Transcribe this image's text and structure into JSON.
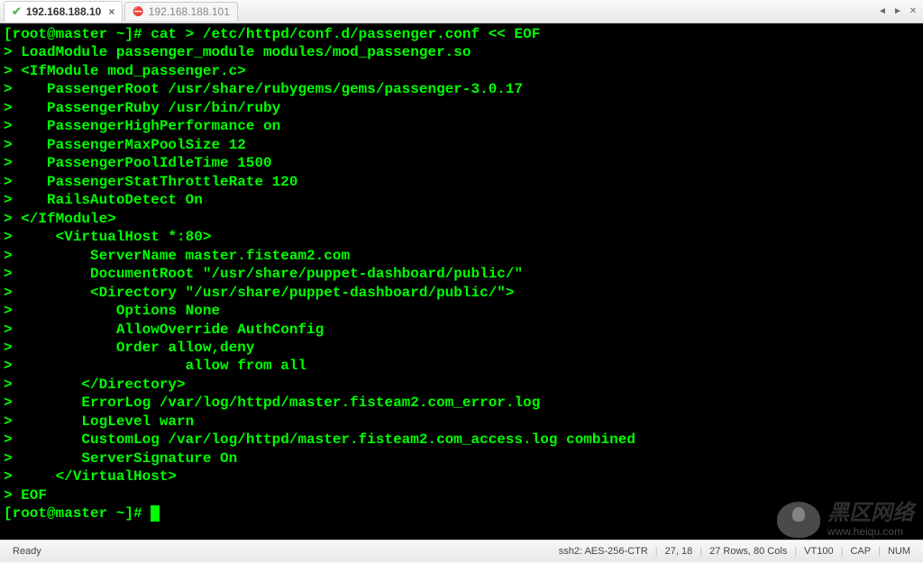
{
  "tabs": {
    "active_label": "192.168.188.10",
    "active_close": "×",
    "inactive_label": "192.168.188.101"
  },
  "terminal": {
    "lines": [
      "[root@master ~]# cat > /etc/httpd/conf.d/passenger.conf << EOF",
      "> LoadModule passenger_module modules/mod_passenger.so",
      "> <IfModule mod_passenger.c>",
      ">    PassengerRoot /usr/share/rubygems/gems/passenger-3.0.17",
      ">    PassengerRuby /usr/bin/ruby",
      ">    PassengerHighPerformance on",
      ">    PassengerMaxPoolSize 12",
      ">    PassengerPoolIdleTime 1500",
      ">    PassengerStatThrottleRate 120",
      ">    RailsAutoDetect On",
      "> </IfModule>",
      ">     <VirtualHost *:80>",
      ">         ServerName master.fisteam2.com",
      ">         DocumentRoot \"/usr/share/puppet-dashboard/public/\"",
      ">         <Directory \"/usr/share/puppet-dashboard/public/\">",
      ">            Options None",
      ">            AllowOverride AuthConfig",
      ">            Order allow,deny",
      ">                    allow from all",
      ">        </Directory>",
      ">        ErrorLog /var/log/httpd/master.fisteam2.com_error.log",
      ">        LogLevel warn",
      ">        CustomLog /var/log/httpd/master.fisteam2.com_access.log combined",
      ">        ServerSignature On",
      ">     </VirtualHost>",
      "> EOF",
      "[root@master ~]# "
    ]
  },
  "status": {
    "ready": "Ready",
    "cipher": "ssh2: AES-256-CTR",
    "pos": "27, 18",
    "size": "27 Rows, 80 Cols",
    "term": "VT100",
    "cap": "CAP",
    "num": "NUM"
  },
  "watermark": {
    "main": "黑区网络",
    "sub": "www.heiqu.com"
  }
}
